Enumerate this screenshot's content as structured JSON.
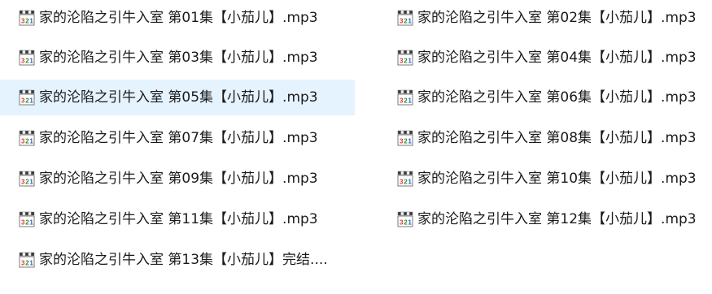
{
  "icon": {
    "name": "media-player-classic-audio-file-icon",
    "digits": "321",
    "colors": {
      "clapper_dark": "#3a3a3a",
      "clapper_light": "#f2f2f2",
      "digit_1": "#d93a2b",
      "digit_2": "#2f8a2f",
      "digit_3": "#2a5fc4",
      "body": "#ffffff",
      "border": "#7a7a7a"
    }
  },
  "selection_color": "#e5f3ff",
  "files": [
    {
      "name": "家的沦陷之引牛入室 第01集【小茄儿】.mp3",
      "column": 0,
      "row": 0,
      "selected": false
    },
    {
      "name": "家的沦陷之引牛入室 第02集【小茄儿】.mp3",
      "column": 1,
      "row": 0,
      "selected": false
    },
    {
      "name": "家的沦陷之引牛入室 第03集【小茄儿】.mp3",
      "column": 0,
      "row": 1,
      "selected": false
    },
    {
      "name": "家的沦陷之引牛入室 第04集【小茄儿】.mp3",
      "column": 1,
      "row": 1,
      "selected": false
    },
    {
      "name": "家的沦陷之引牛入室 第05集【小茄儿】.mp3",
      "column": 0,
      "row": 2,
      "selected": true
    },
    {
      "name": "家的沦陷之引牛入室 第06集【小茄儿】.mp3",
      "column": 1,
      "row": 2,
      "selected": false
    },
    {
      "name": "家的沦陷之引牛入室 第07集【小茄儿】.mp3",
      "column": 0,
      "row": 3,
      "selected": false
    },
    {
      "name": "家的沦陷之引牛入室 第08集【小茄儿】.mp3",
      "column": 1,
      "row": 3,
      "selected": false
    },
    {
      "name": "家的沦陷之引牛入室 第09集【小茄儿】.mp3",
      "column": 0,
      "row": 4,
      "selected": false
    },
    {
      "name": "家的沦陷之引牛入室 第10集【小茄儿】.mp3",
      "column": 1,
      "row": 4,
      "selected": false
    },
    {
      "name": "家的沦陷之引牛入室 第11集【小茄儿】.mp3",
      "column": 0,
      "row": 5,
      "selected": false
    },
    {
      "name": "家的沦陷之引牛入室 第12集【小茄儿】.mp3",
      "column": 1,
      "row": 5,
      "selected": false
    },
    {
      "name": "家的沦陷之引牛入室 第13集【小茄儿】完结....",
      "column": 0,
      "row": 6,
      "selected": false
    }
  ]
}
